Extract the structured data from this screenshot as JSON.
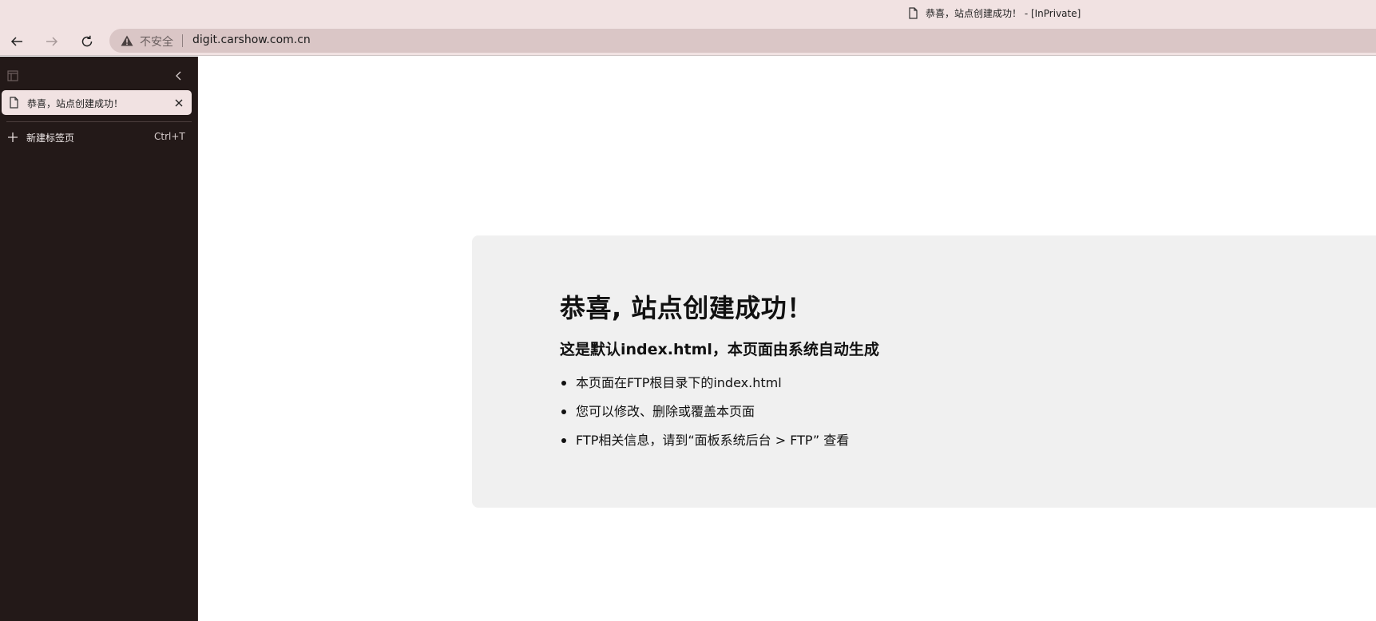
{
  "window": {
    "title": "恭喜，站点创建成功！ - [InPrivate]"
  },
  "toolbar": {
    "back_icon": "back-arrow-icon",
    "forward_icon": "forward-arrow-icon",
    "refresh_icon": "refresh-icon",
    "security_label": "不安全",
    "url": "digit.carshow.com.cn"
  },
  "sidebar": {
    "tabs": [
      {
        "label": "恭喜，站点创建成功！",
        "icon": "document-icon",
        "active": true
      }
    ],
    "new_tab": {
      "label": "新建标签页",
      "shortcut": "Ctrl+T"
    }
  },
  "page": {
    "heading": "恭喜, 站点创建成功！",
    "subheading": "这是默认index.html，本页面由系统自动生成",
    "bullets": [
      "本页面在FTP根目录下的index.html",
      "您可以修改、删除或覆盖本页面",
      "FTP相关信息，请到“面板系统后台 > FTP” 查看"
    ]
  },
  "colors": {
    "titlebar_bg": "#f1e2e2",
    "addressbar_bg": "#dac6c6",
    "sidebar_bg": "#231918",
    "card_bg": "#f0f0f0"
  }
}
